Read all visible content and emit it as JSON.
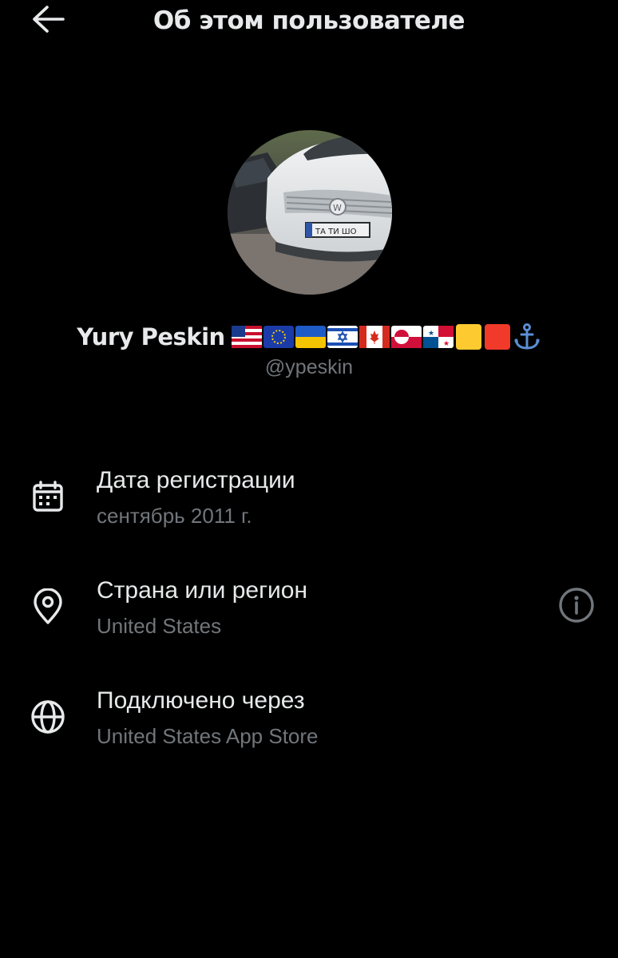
{
  "header": {
    "title": "Об этом пользователе",
    "back_icon": "arrow-left-icon"
  },
  "profile": {
    "display_name": "Yury Peskin",
    "handle": "@ypeskin",
    "avatar_description_icon": "avatar",
    "badges": [
      "flag-us-icon",
      "flag-eu-icon",
      "flag-ua-icon",
      "flag-il-icon",
      "flag-ca-icon",
      "flag-gl-icon",
      "flag-pa-icon",
      "yellow-square-icon",
      "red-square-icon",
      "anchor-icon"
    ]
  },
  "details": [
    {
      "label": "Дата регистрации",
      "value": "сентябрь 2011 г.",
      "icon": "calendar-icon"
    },
    {
      "label": "Страна или регион",
      "value": "United States",
      "icon": "location-pin-icon",
      "action_icon": "info-icon"
    },
    {
      "label": "Подключено через",
      "value": "United States App Store",
      "icon": "globe-icon"
    }
  ],
  "colors": {
    "background": "#000000",
    "primary_text": "#e7e9ea",
    "secondary_text": "#71767b",
    "anchor": "#5b8fd6"
  }
}
